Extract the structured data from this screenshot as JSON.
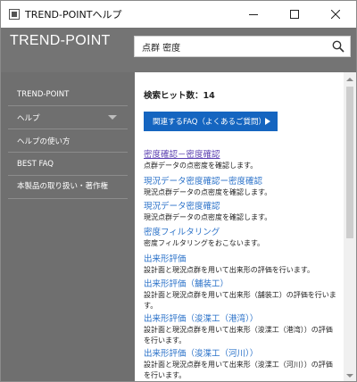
{
  "window": {
    "title": "TREND-POINTヘルプ",
    "controls": {
      "minimize": "minimize-icon",
      "maximize": "maximize-icon",
      "close": "close-icon"
    }
  },
  "header": {
    "brand": "TREND-POINT",
    "search": {
      "value": "点群 密度",
      "placeholder": ""
    }
  },
  "sidebar": {
    "items": [
      {
        "label": "TREND-POINT"
      },
      {
        "label": "ヘルプ",
        "has_submenu": true
      },
      {
        "label": "ヘルプの使い方"
      },
      {
        "label": "BEST FAQ"
      },
      {
        "label": "本製品の取り扱い・著作権"
      }
    ]
  },
  "main": {
    "hit_count_label": "検索ヒット数：14",
    "faq_button_label": "関連するFAQ（よくあるご質問）",
    "results": [
      {
        "title": "密度確認－密度確認",
        "desc": "点群データの点密度を確認します。"
      },
      {
        "title": "現況データ密度確認ー密度確認",
        "desc": "現況点群データの点密度を確認します。"
      },
      {
        "title": "現況データ密度確認",
        "desc": "現況点群データの点密度を確認します。"
      },
      {
        "title": "密度フィルタリング",
        "desc": "密度フィルタリングをおこないます。"
      },
      {
        "title": "出来形評価",
        "desc": "設計面と現況点群を用いて出来形の評価を行います。"
      },
      {
        "title": "出来形評価（舗装工）",
        "desc": "設計面と現況点群を用いて出来形（舗装工）の評価を行いま",
        "desc2": "す。"
      },
      {
        "title": "出来形評価（浚渫工（港湾））",
        "desc": "設計面と現況点群を用いて出来形（浚渫工（港湾））の評価",
        "desc2": "を行います。"
      },
      {
        "title": "出来形評価（浚渫工（河川））",
        "desc": "設計面と現況点群を用いて出来形（浚渫工（河川））の評価",
        "desc2": "を行います。"
      }
    ]
  },
  "colors": {
    "header_bg": "#747474",
    "sidebar_bg": "#6f6f6f",
    "accent_button": "#1565c0",
    "link": "#2b72c9",
    "visited_link": "#5a3fb0"
  }
}
